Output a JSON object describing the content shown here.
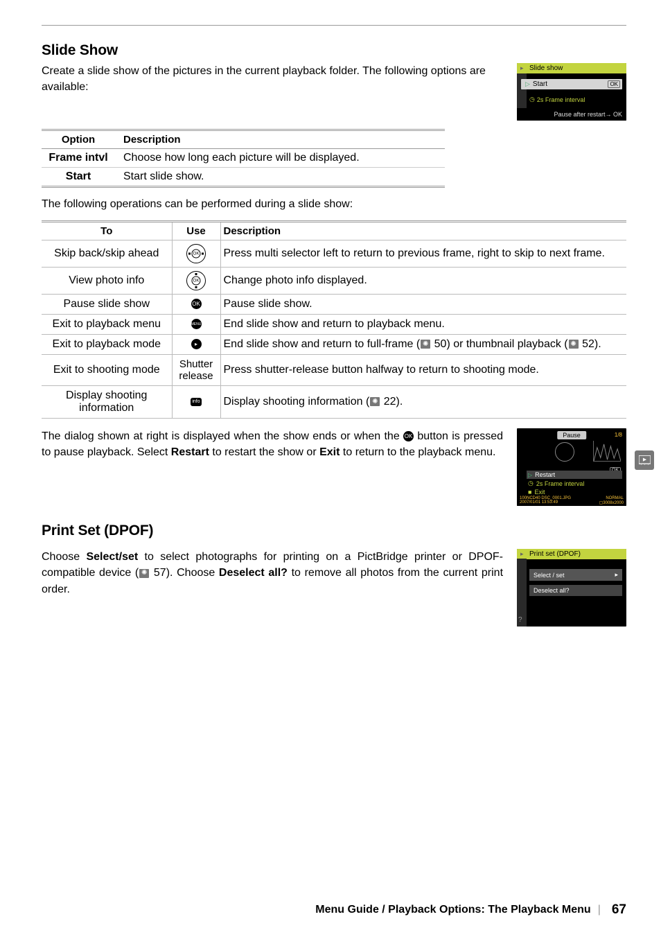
{
  "section1": {
    "heading": "Slide Show",
    "intro": "Create a slide show of the pictures in the current playback folder. The following options are available:"
  },
  "optionsTable": {
    "head": {
      "c1": "Option",
      "c2": "Description"
    },
    "rows": [
      {
        "c1": "Frame intvl",
        "c2": "Choose how long each picture will be displayed."
      },
      {
        "c1": "Start",
        "c2": "Start slide show."
      }
    ]
  },
  "midText": "The following operations can be performed during a slide show:",
  "opsTable": {
    "head": {
      "c1": "To",
      "c2": "Use",
      "c3": "Description"
    },
    "rows": [
      {
        "c1": "Skip back/skip ahead",
        "use": "pad-lr",
        "c3": "Press multi selector left to return to previous frame, right to skip to next frame."
      },
      {
        "c1": "View photo info",
        "use": "pad-ud",
        "c3": "Change photo info displayed."
      },
      {
        "c1": "Pause slide show",
        "use": "ok",
        "c3": "Pause slide show."
      },
      {
        "c1": "Exit to playback menu",
        "use": "menu",
        "c3": "End slide show and return to playback menu."
      },
      {
        "c1": "Exit to playback mode",
        "use": "play",
        "c3a": "End slide show and return to full-frame (",
        "ref1": "50",
        "c3b": ") or thumbnail playback (",
        "ref2": "52",
        "c3c": ")."
      },
      {
        "c1": "Exit to shooting mode",
        "useText": "Shutter release",
        "c3": "Press shutter-release button halfway to return to shooting mode."
      },
      {
        "c1": "Display shooting information",
        "use": "info",
        "c3a": "Display shooting information (",
        "ref1": "22",
        "c3b": ")."
      }
    ]
  },
  "dialogPara": {
    "p1": "The dialog shown at right is displayed when the show ends or when the ",
    "p2": " button is pressed to pause playback.  Select ",
    "restart": "Restart",
    "p3": " to restart the show or ",
    "exit": "Exit",
    "p4": " to return to the playback menu."
  },
  "section2": {
    "heading": "Print Set (DPOF)",
    "p1": "Choose ",
    "selectset": "Select/set",
    "p2": " to select photographs for printing on a PictBridge printer or DPOF-compatible device (",
    "ref": "57",
    "p3": ").  Choose ",
    "deselect": "Deselect all?",
    "p4": " to remove all photos from the current print order."
  },
  "lcd1": {
    "title": "Slide show",
    "start": "Start",
    "interval": "2s Frame interval",
    "footer": "Pause after restart→ OK"
  },
  "lcd2": {
    "pause": "Pause",
    "counter": "1/8",
    "restart": "Restart",
    "interval": "2s Frame interval",
    "exit": "Exit",
    "foot_l": "100NCD40    DSC_0001.JPG",
    "foot_r": "NORMAL",
    "foot_l2": "2007/01/01 13:53:49",
    "foot_r2": "▢3008x2000"
  },
  "lcd3": {
    "title": "Print set (DPOF)",
    "opt1": "Select / set",
    "opt2": "Deselect all?"
  },
  "footer": {
    "text": "Menu Guide / Playback Options: The Playback Menu",
    "page": "67"
  }
}
